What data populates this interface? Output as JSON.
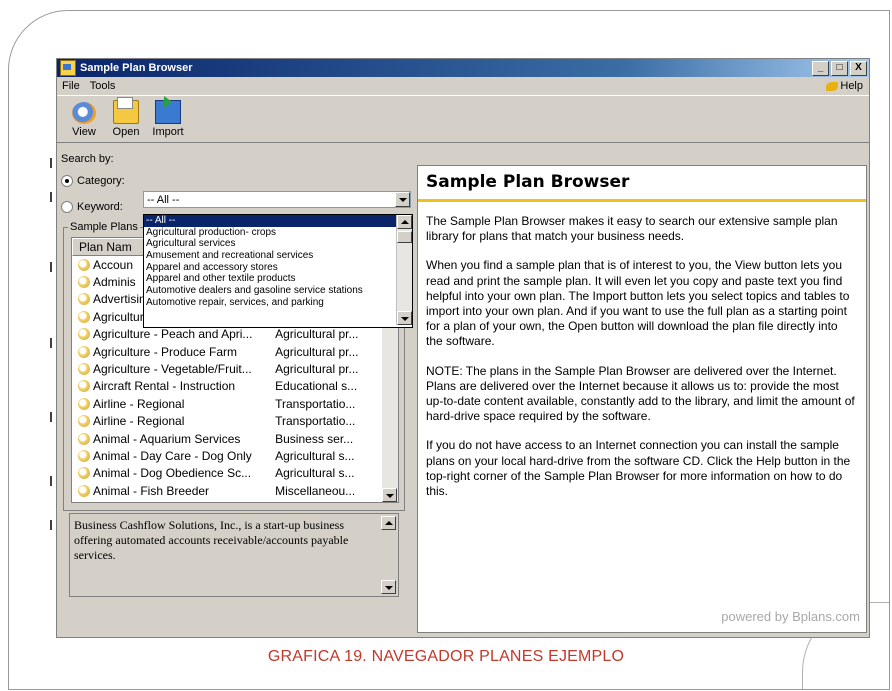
{
  "window": {
    "title": "Sample Plan Browser",
    "controls": [
      "_",
      "□",
      "X"
    ]
  },
  "menu": {
    "file": "File",
    "tools": "Tools",
    "help": "Help"
  },
  "toolbar": {
    "view": "View",
    "open": "Open",
    "import": "Import"
  },
  "search": {
    "label": "Search by:",
    "category_label": "Category:",
    "keyword_label": "Keyword:",
    "category_value": "-- All --",
    "category_options": [
      "-- All --",
      "Agricultural production- crops",
      "Agricultural services",
      "Amusement and recreational services",
      "Apparel and accessory stores",
      "Apparel and other textile products",
      "Automotive dealers and gasoline service stations",
      "Automotive repair, services, and parking"
    ]
  },
  "plans": {
    "group_label": "Sample Plans",
    "col_name": "Plan Nam",
    "col_category": "",
    "rows": [
      {
        "name": "Accoun",
        "category": ""
      },
      {
        "name": "Adminis",
        "category": ""
      },
      {
        "name": "Advertising Agency - Marketi...",
        "category": "Business ser..."
      },
      {
        "name": "Agriculture - Herb Farm - M...",
        "category": "Agricultural pr..."
      },
      {
        "name": "Agriculture - Peach and Apri...",
        "category": "Agricultural pr..."
      },
      {
        "name": "Agriculture - Produce Farm",
        "category": "Agricultural pr..."
      },
      {
        "name": "Agriculture - Vegetable/Fruit...",
        "category": "Agricultural pr..."
      },
      {
        "name": "Aircraft Rental - Instruction",
        "category": "Educational s..."
      },
      {
        "name": "Airline - Regional",
        "category": "Transportatio..."
      },
      {
        "name": "Airline - Regional",
        "category": "Transportatio..."
      },
      {
        "name": "Animal - Aquarium Services",
        "category": "Business ser..."
      },
      {
        "name": "Animal - Day Care - Dog Only",
        "category": "Agricultural s..."
      },
      {
        "name": "Animal - Dog Obedience Sc...",
        "category": "Agricultural s..."
      },
      {
        "name": "Animal - Fish Breeder",
        "category": "Miscellaneou..."
      }
    ]
  },
  "description": "Business Cashflow Solutions, Inc., is a start-up business offering automated accounts receivable/accounts payable services.",
  "content": {
    "heading": "Sample Plan Browser",
    "paragraphs": [
      "The Sample Plan Browser makes it easy to search our extensive sample plan library for plans that match your business needs.",
      "When you find a sample plan that is of interest to you, the View button lets you read and print the sample plan. It will even let you copy and paste text you find helpful into your own plan. The Import button lets you select topics and tables to import into your own plan. And if you want to use the full plan as a starting point for a plan of your own, the Open button will download the plan file directly into the software.",
      "NOTE: The plans in the Sample Plan Browser are delivered over the Internet. Plans are delivered over the Internet because it allows us to: provide the most up-to-date content available, constantly add to the library, and limit the amount of hard-drive space required by the software.",
      "If you do not have access to an Internet connection you can install the sample plans on your local hard-drive from the software CD. Click the Help button in the top-right corner of the Sample Plan Browser for more information on how to do this."
    ],
    "powered_by": "powered by Bplans.com"
  },
  "caption": "GRAFICA 19. NAVEGADOR PLANES EJEMPLO",
  "colors": {
    "title_bar": "#0a246a",
    "accent_rule": "#f0c020",
    "caption": "#c0392b",
    "selection": "#0a246a"
  }
}
